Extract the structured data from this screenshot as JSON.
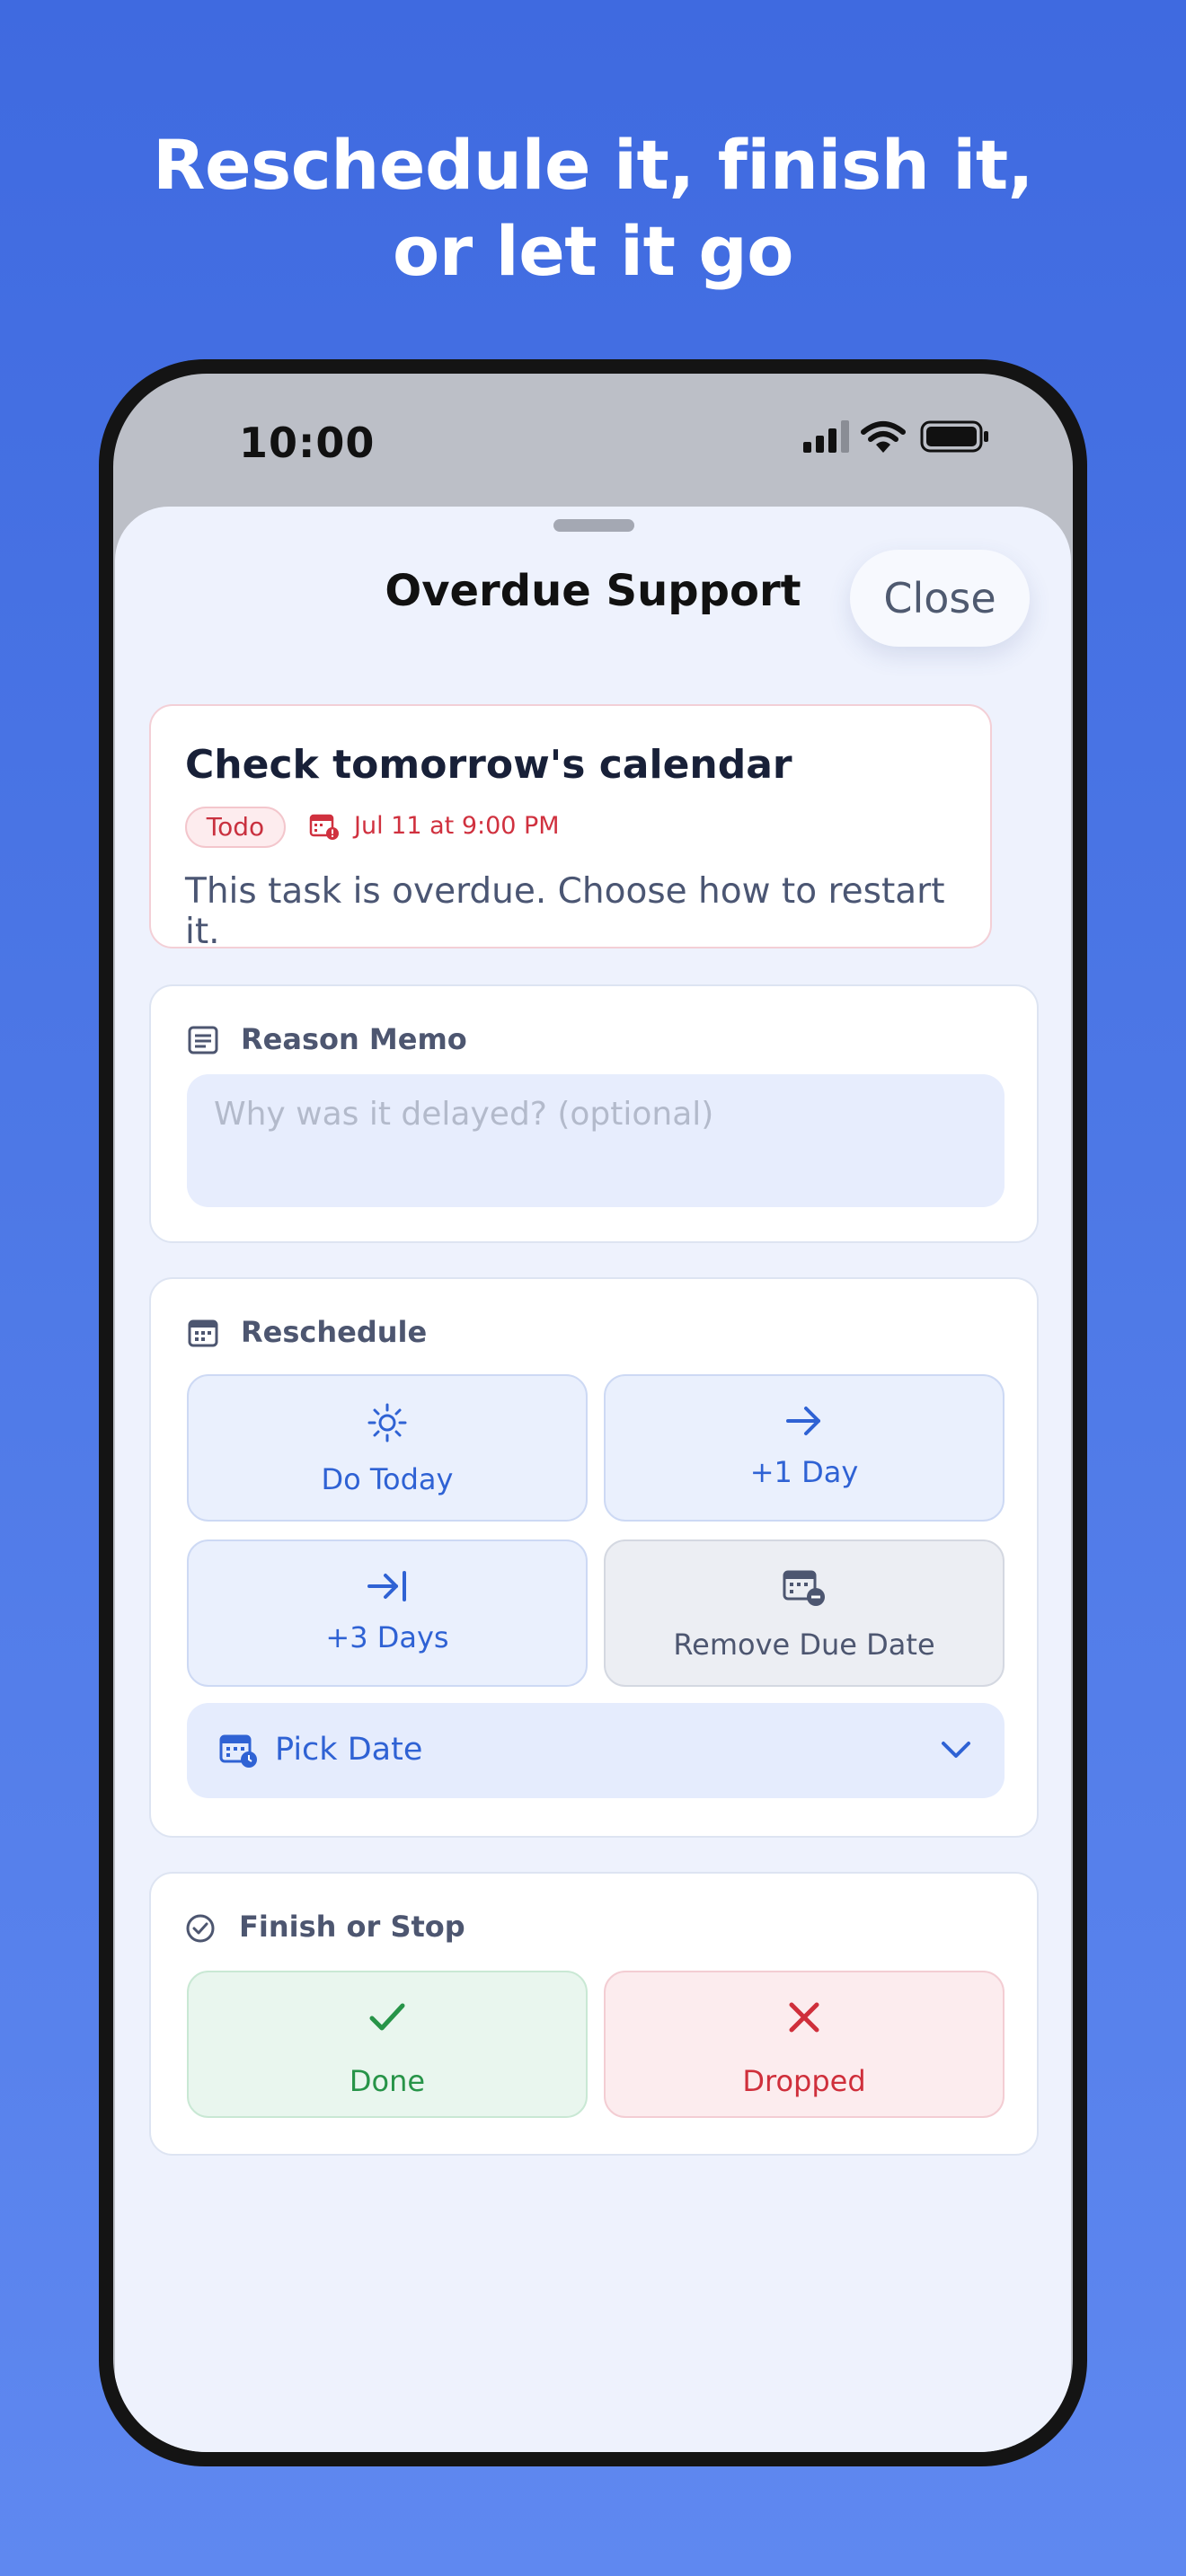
{
  "headline": {
    "line1": "Reschedule it, finish it,",
    "line2": "or let it go"
  },
  "status_bar": {
    "time": "10:00"
  },
  "sheet": {
    "title": "Overdue Support",
    "close_label": "Close"
  },
  "task": {
    "title": "Check tomorrow's calendar",
    "status_badge": "Todo",
    "due_text": "Jul 11 at 9:00 PM",
    "message": "This task is overdue. Choose how to restart it."
  },
  "reason_memo": {
    "label": "Reason Memo",
    "placeholder": "Why was it delayed? (optional)"
  },
  "reschedule": {
    "label": "Reschedule",
    "do_today": "Do Today",
    "plus_one_day": "+1 Day",
    "plus_three_days": "+3 Days",
    "remove_due_date": "Remove Due Date",
    "pick_date": "Pick Date"
  },
  "finish": {
    "label": "Finish or Stop",
    "done": "Done",
    "dropped": "Dropped"
  },
  "colors": {
    "accent": "#2f62d4",
    "danger": "#cf2f3b",
    "success": "#279448",
    "background": "#4d78e6"
  }
}
